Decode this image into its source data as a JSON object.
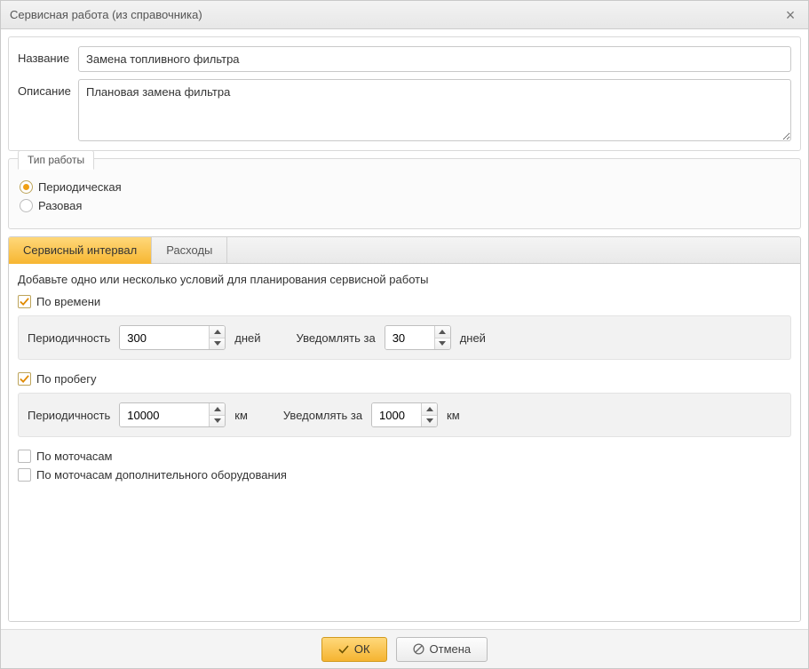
{
  "window": {
    "title": "Сервисная работа (из справочника)"
  },
  "form": {
    "name_label": "Название",
    "name_value": "Замена топливного фильтра",
    "desc_label": "Описание",
    "desc_value": "Плановая замена фильтра"
  },
  "work_type": {
    "legend": "Тип работы",
    "periodic": "Периодическая",
    "onetime": "Разовая"
  },
  "tabs": {
    "interval": "Сервисный интервал",
    "costs": "Расходы"
  },
  "interval": {
    "help": "Добавьте одно или несколько условий для планирования сервисной работы",
    "by_time": "По времени",
    "by_mileage": "По пробегу",
    "by_engine_hours": "По моточасам",
    "by_equip_hours": "По моточасам дополнительного оборудования",
    "period_label": "Периодичность",
    "notify_label": "Уведомлять за",
    "days_unit": "дней",
    "km_unit": "км",
    "time_period_value": "300",
    "time_notify_value": "30",
    "mileage_period_value": "10000",
    "mileage_notify_value": "1000"
  },
  "buttons": {
    "ok": "ОК",
    "cancel": "Отмена"
  }
}
